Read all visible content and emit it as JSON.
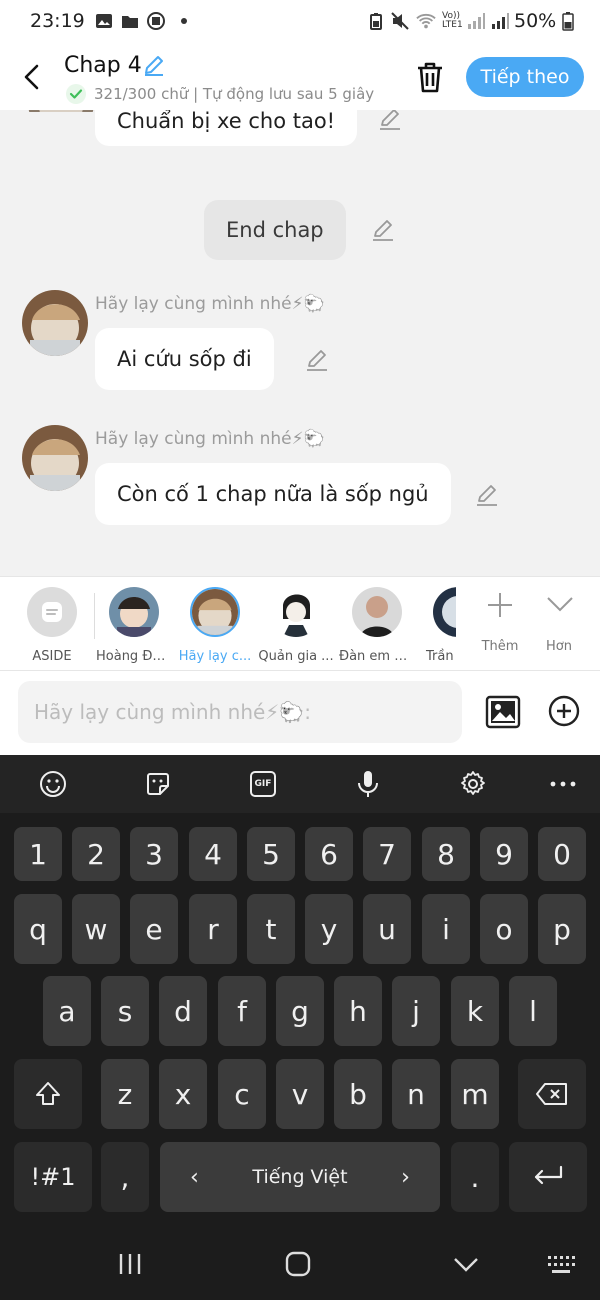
{
  "status_bar": {
    "time": "23:19",
    "battery": "50%",
    "network": "Vo)) LTE1"
  },
  "header": {
    "title": "Chap 4",
    "subtitle": "321/300 chữ | Tự động lưu sau 5 giây",
    "next_label": "Tiếp theo"
  },
  "chat": {
    "messages": [
      {
        "text": "Chuẩn bị xe cho tao!"
      },
      {
        "text": "End chap",
        "style": "narration"
      },
      {
        "sender": "Hãy lạy cùng mình nhé⚡🐑",
        "text": "Ai cứu sốp đi"
      },
      {
        "sender": "Hãy lạy cùng mình nhé⚡🐑",
        "text": "Còn cố 1 chap nữa là sốp ngủ"
      }
    ]
  },
  "characters": {
    "items": [
      {
        "label": "ASIDE"
      },
      {
        "label": "Hoàng Đứ..."
      },
      {
        "label": "Hãy lạy c...",
        "selected": true
      },
      {
        "label": "Quản gia ..."
      },
      {
        "label": "Đàn em Q..."
      },
      {
        "label": "Trần"
      }
    ],
    "add_label": "Thêm",
    "more_label": "Hơn"
  },
  "input": {
    "placeholder": "Hãy lạy cùng mình nhé⚡🐑:"
  },
  "keyboard": {
    "numbers": [
      "1",
      "2",
      "3",
      "4",
      "5",
      "6",
      "7",
      "8",
      "9",
      "0"
    ],
    "row1": [
      "q",
      "w",
      "e",
      "r",
      "t",
      "y",
      "u",
      "i",
      "o",
      "p"
    ],
    "row2": [
      "a",
      "s",
      "d",
      "f",
      "g",
      "h",
      "j",
      "k",
      "l"
    ],
    "row3": [
      "z",
      "x",
      "c",
      "v",
      "b",
      "n",
      "m"
    ],
    "symbols_label": "!#1",
    "comma": ",",
    "space_label": "Tiếng Việt",
    "period": ".",
    "gif_label": "GIF"
  },
  "colors": {
    "accent": "#4aa9f4",
    "keyboard_bg": "#1c1c1c",
    "key_bg": "#3b3b3b"
  }
}
